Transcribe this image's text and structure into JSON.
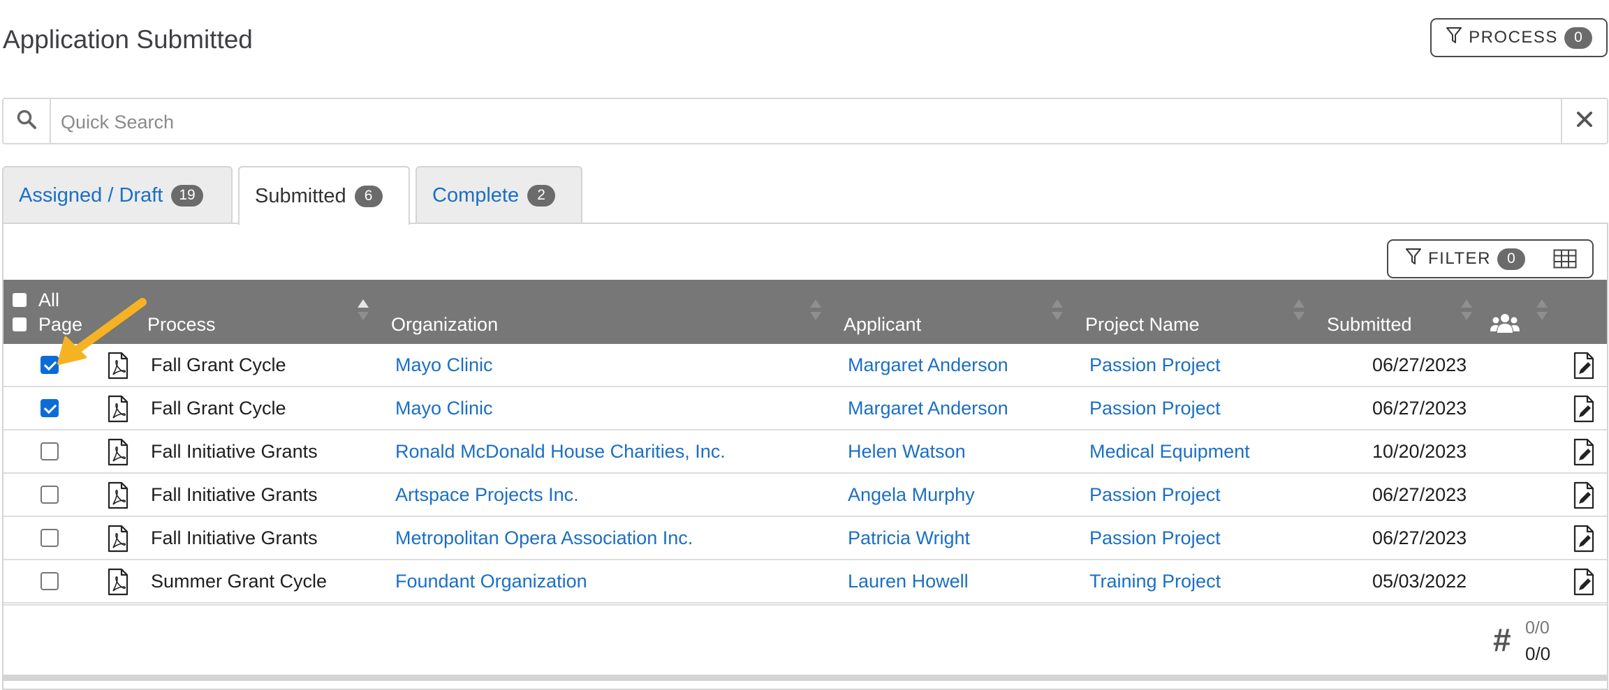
{
  "header": {
    "title": "Application Submitted",
    "process_label": "PROCESS",
    "process_count": "0"
  },
  "search": {
    "placeholder": "Quick Search",
    "value": ""
  },
  "tabs": [
    {
      "label": "Assigned / Draft",
      "count": "19",
      "active": false
    },
    {
      "label": "Submitted",
      "count": "6",
      "active": true
    },
    {
      "label": "Complete",
      "count": "2",
      "active": false
    }
  ],
  "toolbar": {
    "filter_label": "FILTER",
    "filter_count": "0"
  },
  "table": {
    "select_all_label": "All",
    "select_page_label": "Page",
    "columns": {
      "process": "Process",
      "organization": "Organization",
      "applicant": "Applicant",
      "project_name": "Project Name",
      "submitted": "Submitted"
    },
    "rows": [
      {
        "checked": true,
        "process": "Fall Grant Cycle",
        "organization": "Mayo Clinic",
        "applicant": "Margaret Anderson",
        "project": "Passion Project",
        "submitted": "06/27/2023"
      },
      {
        "checked": true,
        "process": "Fall Grant Cycle",
        "organization": "Mayo Clinic",
        "applicant": "Margaret Anderson",
        "project": "Passion Project",
        "submitted": "06/27/2023"
      },
      {
        "checked": false,
        "process": "Fall Initiative Grants",
        "organization": "Ronald McDonald House Charities, Inc.",
        "applicant": "Helen Watson",
        "project": "Medical Equipment",
        "submitted": "10/20/2023"
      },
      {
        "checked": false,
        "process": "Fall Initiative Grants",
        "organization": "Artspace Projects Inc.",
        "applicant": "Angela Murphy",
        "project": "Passion Project",
        "submitted": "06/27/2023"
      },
      {
        "checked": false,
        "process": "Fall Initiative Grants",
        "organization": "Metropolitan Opera Association Inc.",
        "applicant": "Patricia Wright",
        "project": "Passion Project",
        "submitted": "06/27/2023"
      },
      {
        "checked": false,
        "process": "Summer Grant Cycle",
        "organization": "Foundant Organization",
        "applicant": "Lauren Howell",
        "project": "Training Project",
        "submitted": "05/03/2022"
      }
    ]
  },
  "footer": {
    "count_symbol": "#",
    "count_top": "0/0",
    "count_bottom": "0/0"
  },
  "colors": {
    "link": "#1b6fc4",
    "header_bg": "#777777",
    "checkbox_checked": "#0b6cd9",
    "annotation_arrow": "#f5b323"
  },
  "icons": [
    "search-icon",
    "close-icon",
    "funnel-icon",
    "table-grid-icon",
    "users-icon",
    "pdf-file-icon",
    "edit-document-icon",
    "sort-icon",
    "annotation-arrow"
  ]
}
